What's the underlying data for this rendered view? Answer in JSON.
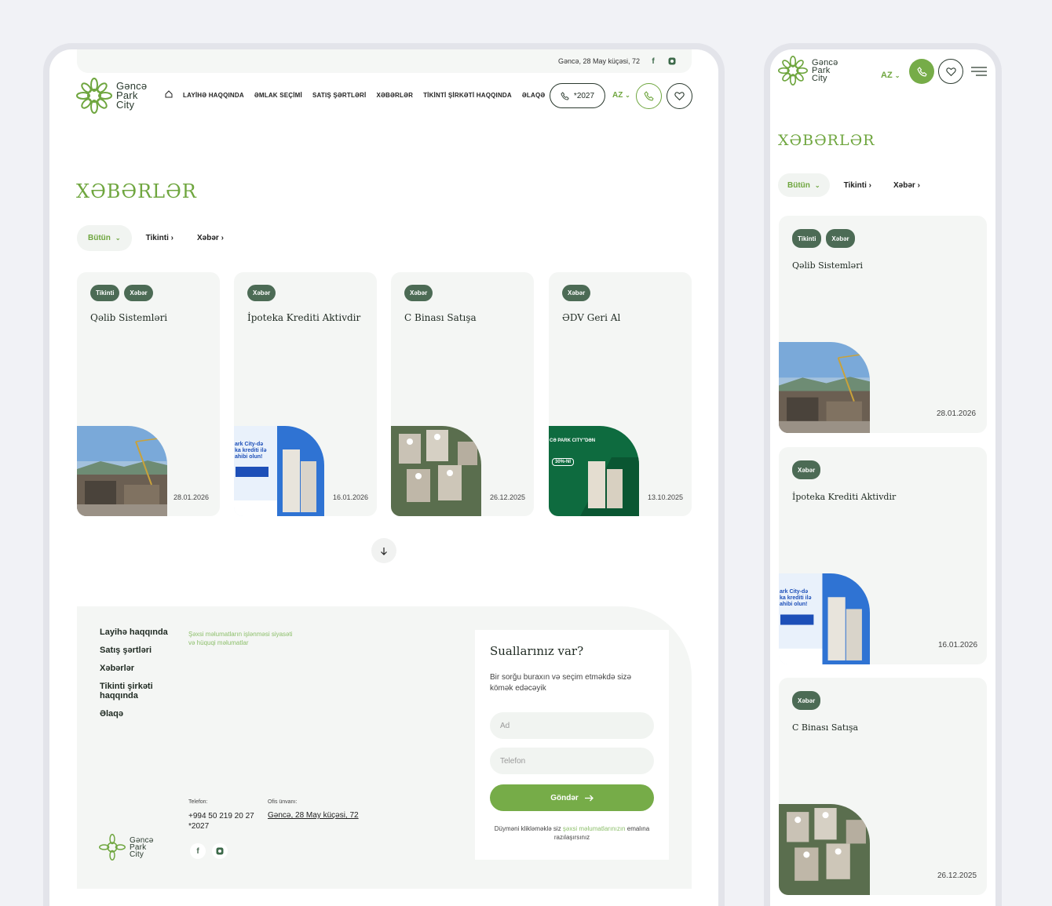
{
  "desktop": {
    "topbar": {
      "address": "Gəncə, 28 May küçəsi, 72",
      "facebook_icon": "f",
      "instagram_icon": "◘"
    },
    "logo": {
      "line1": "Gəncə",
      "line2": "Park",
      "line3": "City"
    },
    "nav": [
      "LAYİHƏ HAQQINDA",
      "ƏMLAK SEÇİMİ",
      "SATIŞ ŞƏRTLƏRİ",
      "XƏBƏRLƏR",
      "TİKİNTİ ŞİRKƏTİ HAQQINDA",
      "ƏLAQƏ"
    ],
    "phone_button": "*2027",
    "lang": "AZ",
    "page_title": "XƏBƏRLƏR",
    "filters": {
      "all": "Bütün",
      "construction": "Tikinti",
      "news": "Xəbər"
    },
    "cards": [
      {
        "tags": [
          "Tikinti",
          "Xəbər"
        ],
        "title": "Qəlib Sistemləri",
        "date": "28.01.2026"
      },
      {
        "tags": [
          "Xəbər"
        ],
        "title": "İpoteka Krediti Aktivdir",
        "date": "16.01.2026"
      },
      {
        "tags": [
          "Xəbər"
        ],
        "title": "C Binası Satışa",
        "date": "26.12.2025"
      },
      {
        "tags": [
          "Xəbər"
        ],
        "title": "ƏDV Geri Al",
        "date": "13.10.2025"
      }
    ],
    "card_thumb_texts": {
      "ipoteka": [
        "ark City-də",
        "ka krediti ilə",
        "ahibi olun!"
      ],
      "edv": [
        "CƏ PARK CITY\"DƏN",
        "30%-Nİ"
      ]
    },
    "footer": {
      "links": [
        "Layihə haqqında",
        "Satış şərtləri",
        "Xəbərlər",
        "Tikinti şirkəti haqqında",
        "Əlaqə"
      ],
      "privacy": "Şəxsi məlumatların işlənməsi siyasəti və hüquqi məlumatlar",
      "phone_label": "Telefon:",
      "phone1": "+994 50 219 20 27",
      "phone2": "*2027",
      "office_label": "Ofis ünvanı:",
      "office": "Gəncə, 28 May küçəsi, 72",
      "form_title": "Suallarınız var?",
      "form_text": "Bir sorğu buraxın və seçim etməkdə sizə kömək edəcəyik",
      "name_placeholder": "Ad",
      "phone_placeholder": "Telefon",
      "send": "Göndər",
      "consent_pre": "Düyməni klikləməklə siz ",
      "consent_link": "şəxsi məlumatlarınızın",
      "consent_post": " emalına razılaşırsınız"
    }
  },
  "mobile": {
    "lang": "AZ",
    "page_title": "XƏBƏRLƏR",
    "filters": {
      "all": "Bütün",
      "construction": "Tikinti",
      "news": "Xəbər"
    },
    "cards": [
      {
        "tags": [
          "Tikinti",
          "Xəbər"
        ],
        "title": "Qəlib Sistemləri",
        "date": "28.01.2026"
      },
      {
        "tags": [
          "Xəbər"
        ],
        "title": "İpoteka Krediti Aktivdir",
        "date": "16.01.2026"
      },
      {
        "tags": [
          "Xəbər"
        ],
        "title": "C Binası Satışa",
        "date": "26.12.2025"
      }
    ]
  },
  "icons": {
    "home": "home-icon",
    "phone": "phone-icon",
    "heart": "heart-icon",
    "menu": "menu-icon",
    "arrow_down": "arrow-down-icon",
    "chevron": "chevron-icon"
  },
  "colors": {
    "accent": "#6fa63f",
    "tag": "#4c6b55",
    "card_bg": "#f4f6f4",
    "button": "#76ac48"
  }
}
